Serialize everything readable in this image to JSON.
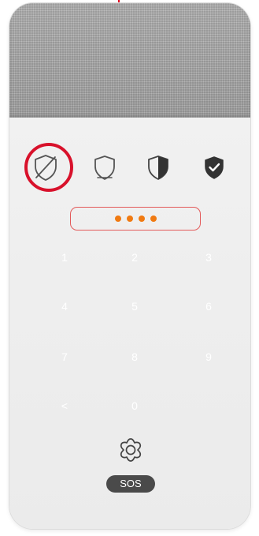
{
  "device": {
    "accent_color": "#d8112b",
    "modes": [
      {
        "icon": "shield-slash-icon",
        "state": "disarmed",
        "selected": true
      },
      {
        "icon": "shield-outline-icon",
        "state": "perimeter",
        "selected": false
      },
      {
        "icon": "shield-half-icon",
        "state": "partial",
        "selected": false
      },
      {
        "icon": "shield-check-icon",
        "state": "armed",
        "selected": false
      }
    ],
    "pin": {
      "entered_digits": 4,
      "dot_color": "#f07a12",
      "border_color": "#e35a5a"
    },
    "keypad": {
      "key_color": "#ffffff",
      "rows": [
        [
          "1",
          "2",
          "3"
        ],
        [
          "4",
          "5",
          "6"
        ],
        [
          "7",
          "8",
          "9"
        ],
        [
          "<",
          "0",
          ""
        ]
      ]
    },
    "sos": {
      "icon": "flower-alarm-icon",
      "label": "SOS"
    }
  }
}
